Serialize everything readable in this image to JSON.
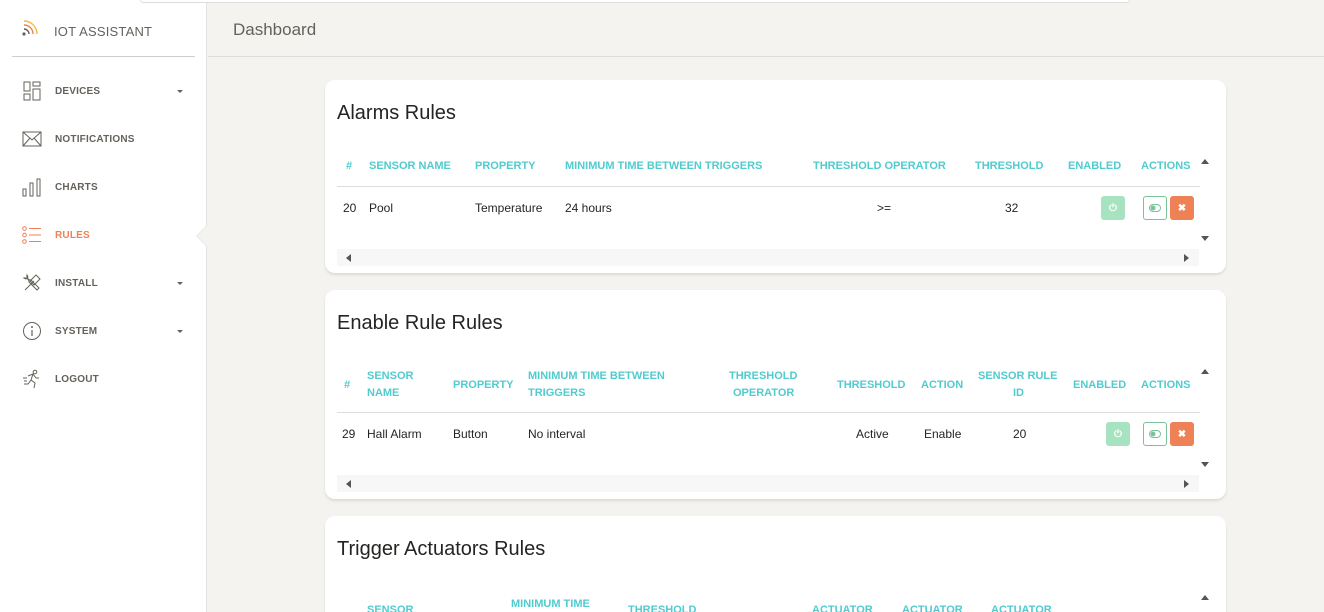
{
  "app": {
    "title": "IOT ASSISTANT",
    "accent": "#ef8157",
    "header_color": "#51cbce"
  },
  "header": {
    "title": "Dashboard"
  },
  "sidebar": {
    "items": [
      {
        "label": "DEVICES",
        "icon": "grid-icon",
        "has_caret": true
      },
      {
        "label": "NOTIFICATIONS",
        "icon": "envelope-icon",
        "has_caret": false
      },
      {
        "label": "CHARTS",
        "icon": "bar-chart-icon",
        "has_caret": false
      },
      {
        "label": "RULES",
        "icon": "list-icon",
        "has_caret": false,
        "active": true
      },
      {
        "label": "INSTALL",
        "icon": "tools-icon",
        "has_caret": true
      },
      {
        "label": "SYSTEM",
        "icon": "info-icon",
        "has_caret": true
      },
      {
        "label": "LOGOUT",
        "icon": "runner-icon",
        "has_caret": false
      }
    ]
  },
  "alarms": {
    "title": "Alarms Rules",
    "headers": [
      "#",
      "SENSOR NAME",
      "PROPERTY",
      "MINIMUM TIME BETWEEN TRIGGERS",
      "THRESHOLD OPERATOR",
      "THRESHOLD",
      "ENABLED",
      "ACTIONS"
    ],
    "row": {
      "id": "20",
      "sensor": "Pool",
      "property": "Temperature",
      "min_time": "24 hours",
      "operator": ">=",
      "threshold": "32"
    }
  },
  "enable_rules": {
    "title": "Enable Rule Rules",
    "headers": {
      "hash": "#",
      "sensor_1": "SENSOR",
      "sensor_2": "NAME",
      "property": "PROPERTY",
      "min_1": "MINIMUM TIME BETWEEN",
      "min_2": "TRIGGERS",
      "op_1": "THRESHOLD",
      "op_2": "OPERATOR",
      "threshold": "THRESHOLD",
      "action": "ACTION",
      "rule_1": "SENSOR RULE",
      "rule_2": "ID",
      "enabled": "ENABLED",
      "actions": "ACTIONS"
    },
    "row": {
      "id": "29",
      "sensor": "Hall Alarm",
      "property": "Button",
      "min_time": "No interval",
      "operator": "",
      "threshold": "Active",
      "action": "Enable",
      "rule_id": "20"
    }
  },
  "trigger": {
    "title": "Trigger Actuators Rules",
    "headers": {
      "sensor": "SENSOR",
      "min_time": "MINIMUM TIME",
      "threshold": "THRESHOLD",
      "actuator_1": "ACTUATOR",
      "actuator_2": "ACTUATOR",
      "actuator_3": "ACTUATOR"
    }
  },
  "buttons": {
    "power": "⏻",
    "toggle": "◐",
    "delete": "✖"
  }
}
